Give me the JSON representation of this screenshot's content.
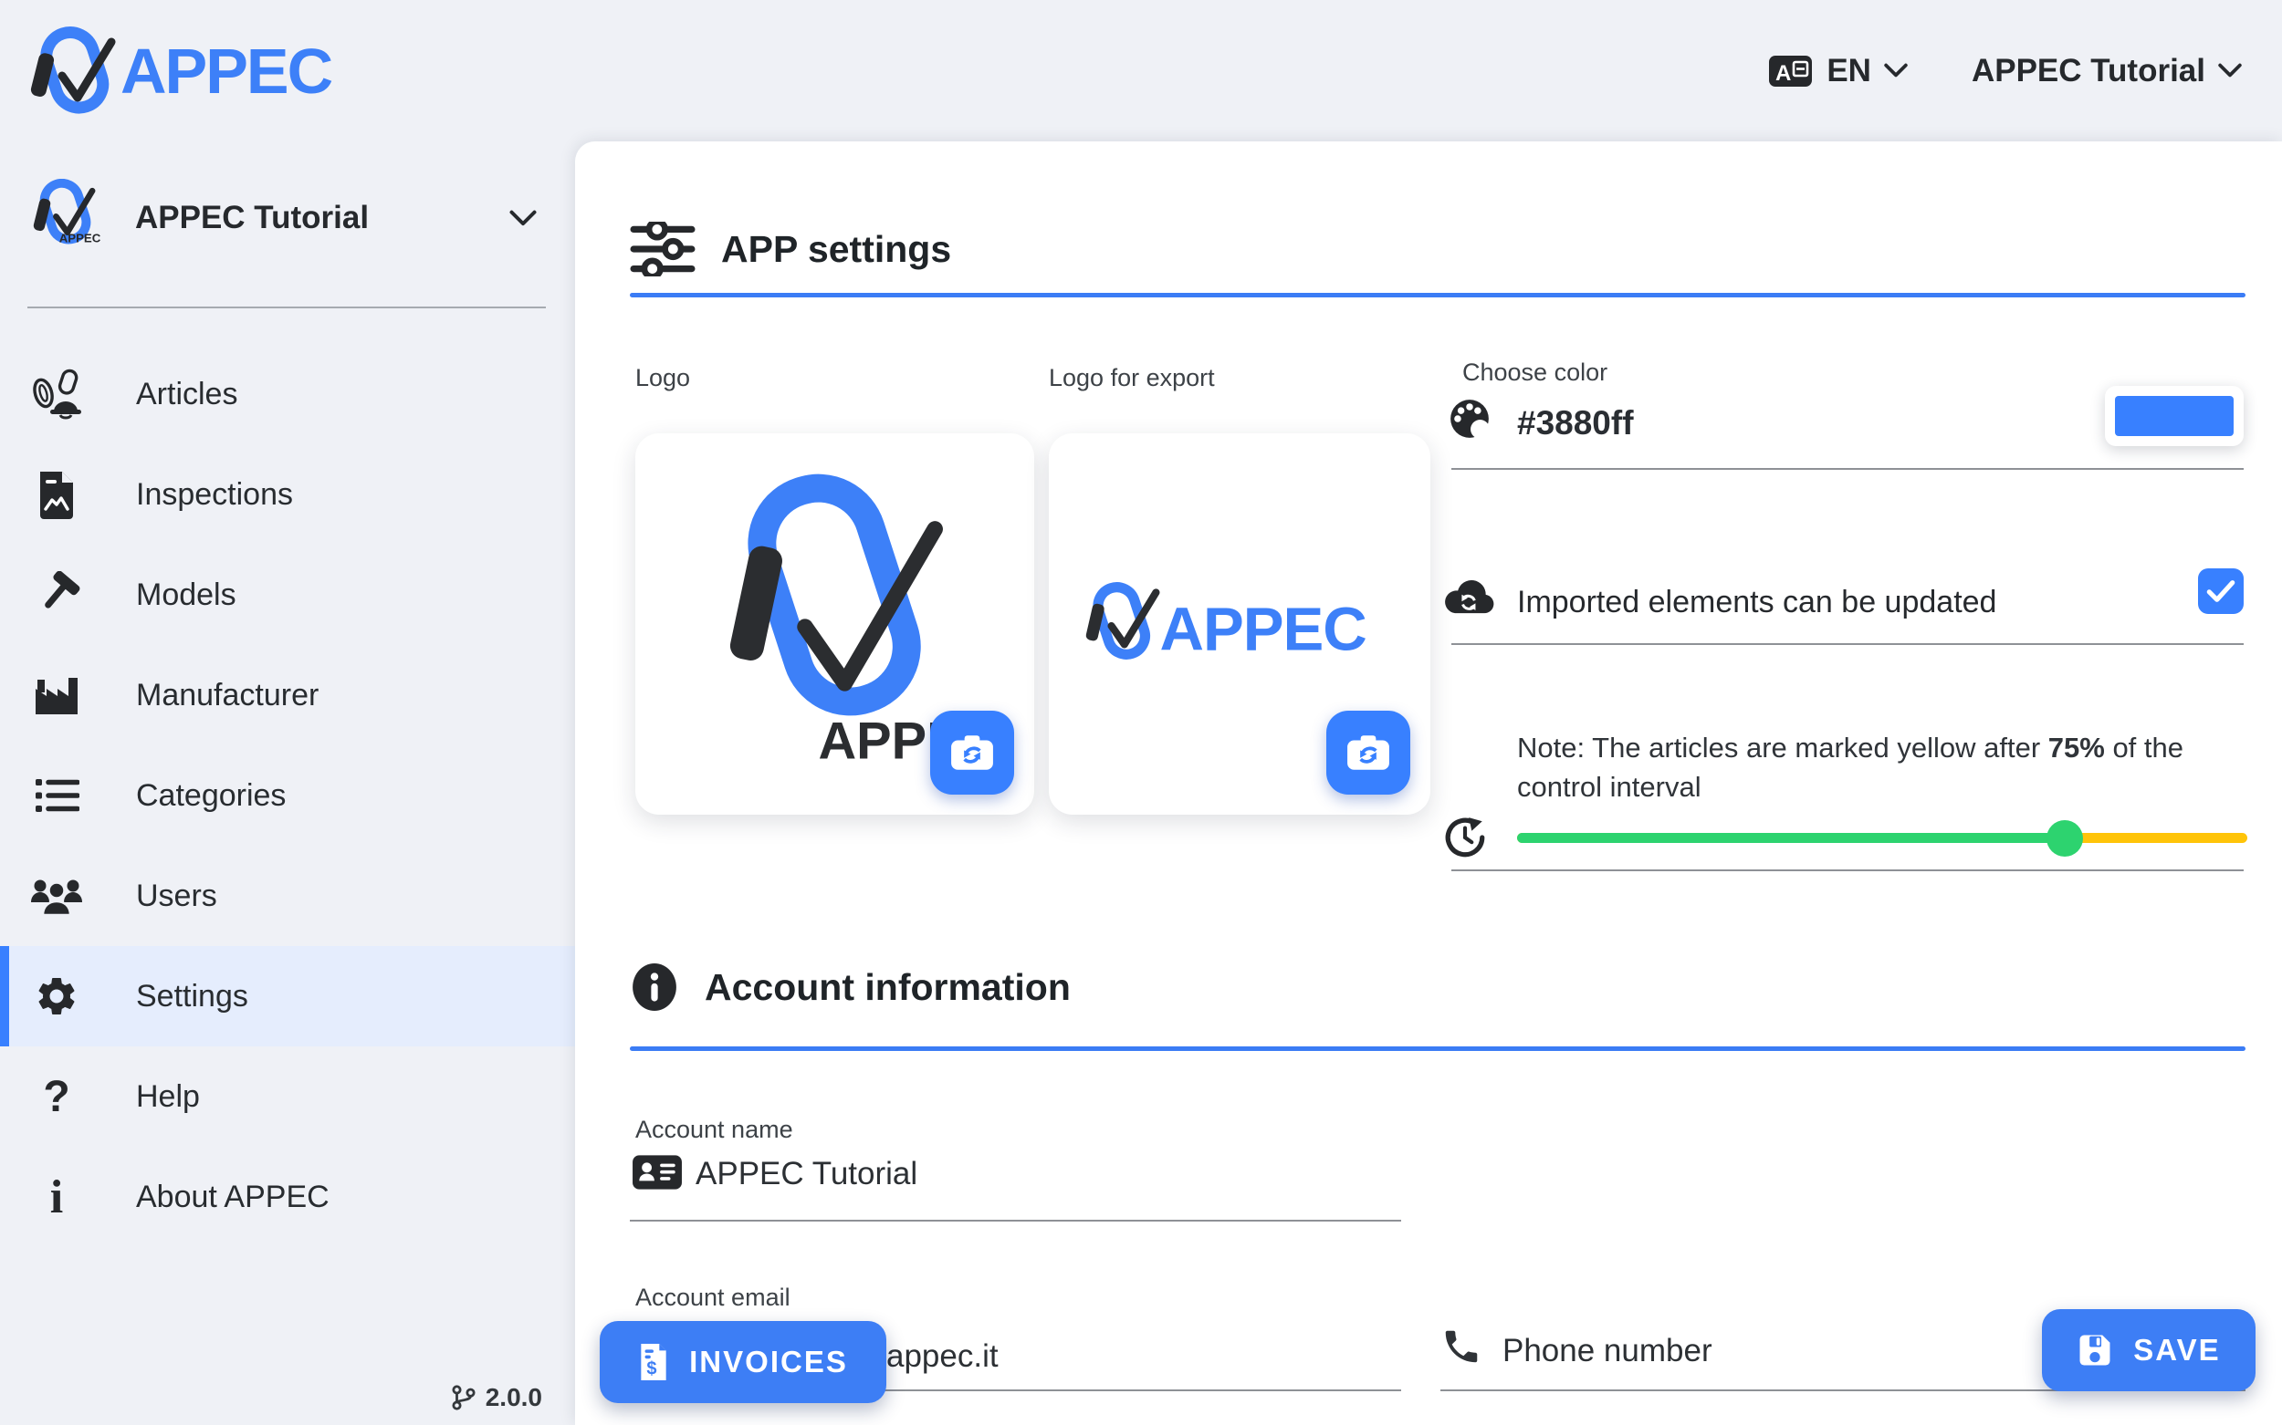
{
  "colors": {
    "primary": "#3880ff",
    "success": "#2dd36f",
    "warning": "#ffc409",
    "sidebar_active_bg": "#e5edfd"
  },
  "header": {
    "brand": "APPEC",
    "language": "EN",
    "account": "APPEC Tutorial"
  },
  "sidebar": {
    "workspace": "APPEC Tutorial",
    "items": [
      {
        "label": "Articles",
        "active": false
      },
      {
        "label": "Inspections",
        "active": false
      },
      {
        "label": "Models",
        "active": false
      },
      {
        "label": "Manufacturer",
        "active": false
      },
      {
        "label": "Categories",
        "active": false
      },
      {
        "label": "Users",
        "active": false
      },
      {
        "label": "Settings",
        "active": true
      },
      {
        "label": "Help",
        "active": false
      },
      {
        "label": "About APPEC",
        "active": false
      }
    ],
    "version": "2.0.0"
  },
  "settings_section": {
    "title": "APP settings",
    "logo_label": "Logo",
    "logo_export_label": "Logo for export",
    "choose_color_label": "Choose color",
    "color_value": "#3880ff",
    "imported_label": "Imported elements can be updated",
    "imported_checked": true,
    "note_prefix": "Note: The articles are marked yellow after ",
    "note_bold": "75%",
    "note_suffix": " of the control interval",
    "slider_percent": 75
  },
  "account_section": {
    "title": "Account information",
    "name_label": "Account name",
    "name_value": "APPEC Tutorial",
    "email_label": "Account email",
    "email_value_visible": "appec.it",
    "phone_placeholder": "Phone number"
  },
  "actions": {
    "invoices": "INVOICES",
    "save": "SAVE"
  }
}
